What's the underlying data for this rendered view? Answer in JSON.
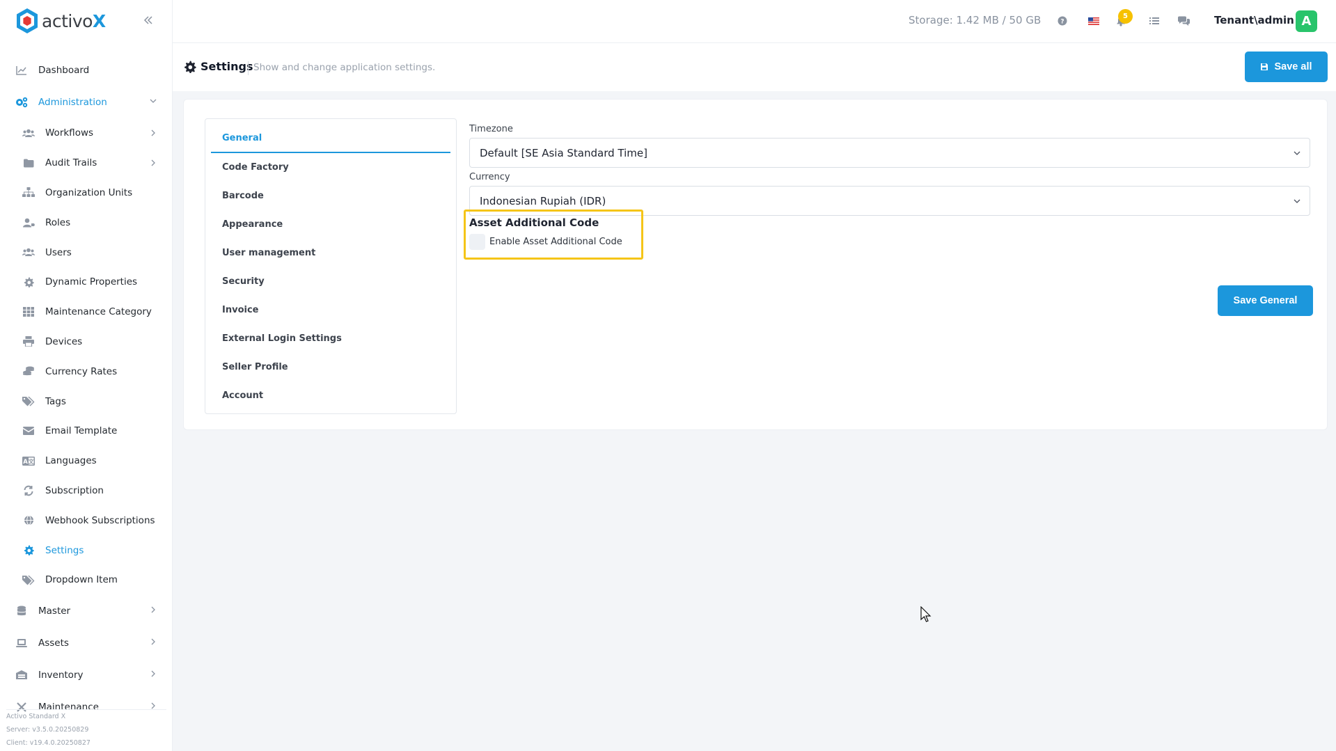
{
  "brand": {
    "name_prefix": "activo",
    "name_suffix": "X"
  },
  "nav": {
    "dashboard": "Dashboard",
    "administration": "Administration",
    "admin_items": [
      {
        "label": "Workflows",
        "icon": "users-icon",
        "chevron": true
      },
      {
        "label": "Audit Trails",
        "icon": "folder-icon",
        "chevron": true
      },
      {
        "label": "Organization Units",
        "icon": "sitemap-icon",
        "chevron": false
      },
      {
        "label": "Roles",
        "icon": "user-tag-icon",
        "chevron": false
      },
      {
        "label": "Users",
        "icon": "users-icon",
        "chevron": false
      },
      {
        "label": "Dynamic Properties",
        "icon": "cog-icon",
        "chevron": false
      },
      {
        "label": "Maintenance Category",
        "icon": "grid-icon",
        "chevron": false
      },
      {
        "label": "Devices",
        "icon": "printer-icon",
        "chevron": false
      },
      {
        "label": "Currency Rates",
        "icon": "coins-icon",
        "chevron": false
      },
      {
        "label": "Tags",
        "icon": "tags-icon",
        "chevron": false
      },
      {
        "label": "Email Template",
        "icon": "envelope-icon",
        "chevron": false
      },
      {
        "label": "Languages",
        "icon": "language-icon",
        "chevron": false
      },
      {
        "label": "Subscription",
        "icon": "sync-icon",
        "chevron": false
      },
      {
        "label": "Webhook Subscriptions",
        "icon": "globe-icon",
        "chevron": false
      },
      {
        "label": "Settings",
        "icon": "cog-icon",
        "chevron": false,
        "active": true
      },
      {
        "label": "Dropdown Item",
        "icon": "tags-icon",
        "chevron": false
      }
    ],
    "master": "Master",
    "assets": "Assets",
    "inventory": "Inventory",
    "maintenance": "Maintenance"
  },
  "version": {
    "product": "Activo Standard X",
    "server": "Server: v3.5.0.20250829",
    "client": "Client: v19.4.0.20250827"
  },
  "topbar": {
    "storage": "Storage: 1.42 MB / 50 GB",
    "notification_count": "5",
    "user": "Tenant\\admin",
    "avatar_letter": "A"
  },
  "subheader": {
    "title": "Settings",
    "description": "Show and change application settings.",
    "save_all": "Save all"
  },
  "tabs": [
    {
      "label": "General",
      "active": true
    },
    {
      "label": "Code Factory"
    },
    {
      "label": "Barcode"
    },
    {
      "label": "Appearance"
    },
    {
      "label": "User management"
    },
    {
      "label": "Security"
    },
    {
      "label": "Invoice"
    },
    {
      "label": "External Login Settings"
    },
    {
      "label": "Seller Profile"
    },
    {
      "label": "Account"
    }
  ],
  "general": {
    "timezone_label": "Timezone",
    "timezone_value": "Default [SE Asia Standard Time]",
    "currency_label": "Currency",
    "currency_value": "Indonesian Rupiah (IDR)",
    "aac_title": "Asset Additional Code",
    "aac_checkbox_label": "Enable Asset Additional Code",
    "aac_checked": false,
    "save_button": "Save General"
  },
  "colors": {
    "accent": "#1c97dc",
    "highlight": "#f5c518",
    "badge": "#f6c100",
    "avatar": "#29c46b"
  }
}
